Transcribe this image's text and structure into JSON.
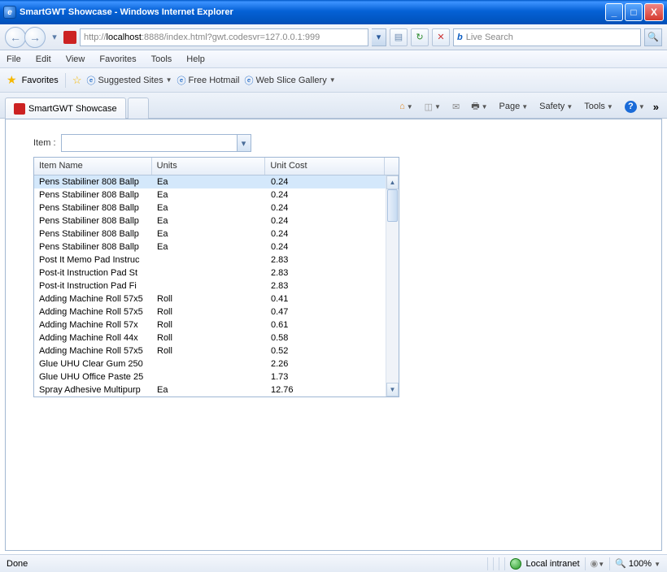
{
  "window": {
    "title": "SmartGWT Showcase - Windows Internet Explorer",
    "min": "_",
    "max": "□",
    "close": "X"
  },
  "nav": {
    "url_prefix": "http://",
    "url_host": "localhost",
    "url_port": ":8888",
    "url_path": "/index.html?gwt.codesvr=127.0.0.1:999",
    "refresh": "↻",
    "stop": "✕",
    "search_placeholder": "Live Search",
    "search_icon": "b"
  },
  "menu": {
    "file": "File",
    "edit": "Edit",
    "view": "View",
    "favorites": "Favorites",
    "tools": "Tools",
    "help": "Help"
  },
  "favbar": {
    "favorites": "Favorites",
    "suggested": "Suggested Sites",
    "hotmail": "Free Hotmail",
    "webslice": "Web Slice Gallery"
  },
  "tabs": {
    "active": "SmartGWT Showcase"
  },
  "commands": {
    "page": "Page",
    "safety": "Safety",
    "tools": "Tools"
  },
  "form": {
    "item_label": "Item :"
  },
  "grid": {
    "headers": {
      "name": "Item Name",
      "units": "Units",
      "cost": "Unit Cost"
    },
    "rows": [
      {
        "name": "Pens Stabiliner 808 Ballp",
        "units": "Ea",
        "cost": "0.24"
      },
      {
        "name": "Pens Stabiliner 808 Ballp",
        "units": "Ea",
        "cost": "0.24"
      },
      {
        "name": "Pens Stabiliner 808 Ballp",
        "units": "Ea",
        "cost": "0.24"
      },
      {
        "name": "Pens Stabiliner 808 Ballp",
        "units": "Ea",
        "cost": "0.24"
      },
      {
        "name": "Pens Stabiliner 808 Ballp",
        "units": "Ea",
        "cost": "0.24"
      },
      {
        "name": "Pens Stabiliner 808 Ballp",
        "units": "Ea",
        "cost": "0.24"
      },
      {
        "name": "Post It Memo Pad Instruc",
        "units": "",
        "cost": "2.83"
      },
      {
        "name": "Post-it Instruction Pad St",
        "units": "",
        "cost": "2.83"
      },
      {
        "name": "Post-it Instruction Pad Fi",
        "units": "",
        "cost": "2.83"
      },
      {
        "name": "Adding Machine Roll 57x5",
        "units": "Roll",
        "cost": "0.41"
      },
      {
        "name": "Adding Machine Roll 57x5",
        "units": "Roll",
        "cost": "0.47"
      },
      {
        "name": "Adding Machine Roll 57x",
        "units": "Roll",
        "cost": "0.61"
      },
      {
        "name": "Adding Machine Roll 44x",
        "units": "Roll",
        "cost": "0.58"
      },
      {
        "name": "Adding Machine Roll 57x5",
        "units": "Roll",
        "cost": "0.52"
      },
      {
        "name": "Glue UHU Clear Gum 250",
        "units": "",
        "cost": "2.26"
      },
      {
        "name": "Glue UHU Office Paste 25",
        "units": "",
        "cost": "1.73"
      },
      {
        "name": "Spray Adhesive Multipurp",
        "units": "Ea",
        "cost": "12.76"
      }
    ]
  },
  "status": {
    "left": "Done",
    "zone": "Local intranet",
    "zoom": "100%"
  }
}
